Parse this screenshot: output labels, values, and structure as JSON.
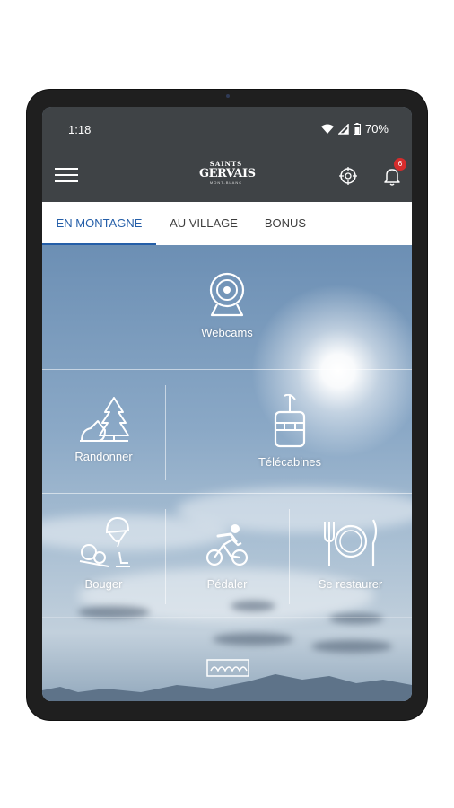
{
  "status_bar": {
    "time": "1:18",
    "battery": "70%"
  },
  "app_bar": {
    "logo_line1": "SAINTS",
    "logo_line2": "GERVAIS",
    "logo_sub": "MONT-BLANC",
    "notification_count": "6"
  },
  "tabs": [
    {
      "label": "EN MONTAGNE",
      "active": true
    },
    {
      "label": "AU VILLAGE",
      "active": false
    },
    {
      "label": "BONUS",
      "active": false
    }
  ],
  "tiles": {
    "webcams": "Webcams",
    "randonner": "Randonner",
    "telecabines": "Télécabines",
    "bouger": "Bouger",
    "pedaler": "Pédaler",
    "se_restaurer": "Se restaurer"
  },
  "colors": {
    "bar": "#3f4346",
    "accent": "#245ea8",
    "badge": "#d62c2c"
  }
}
